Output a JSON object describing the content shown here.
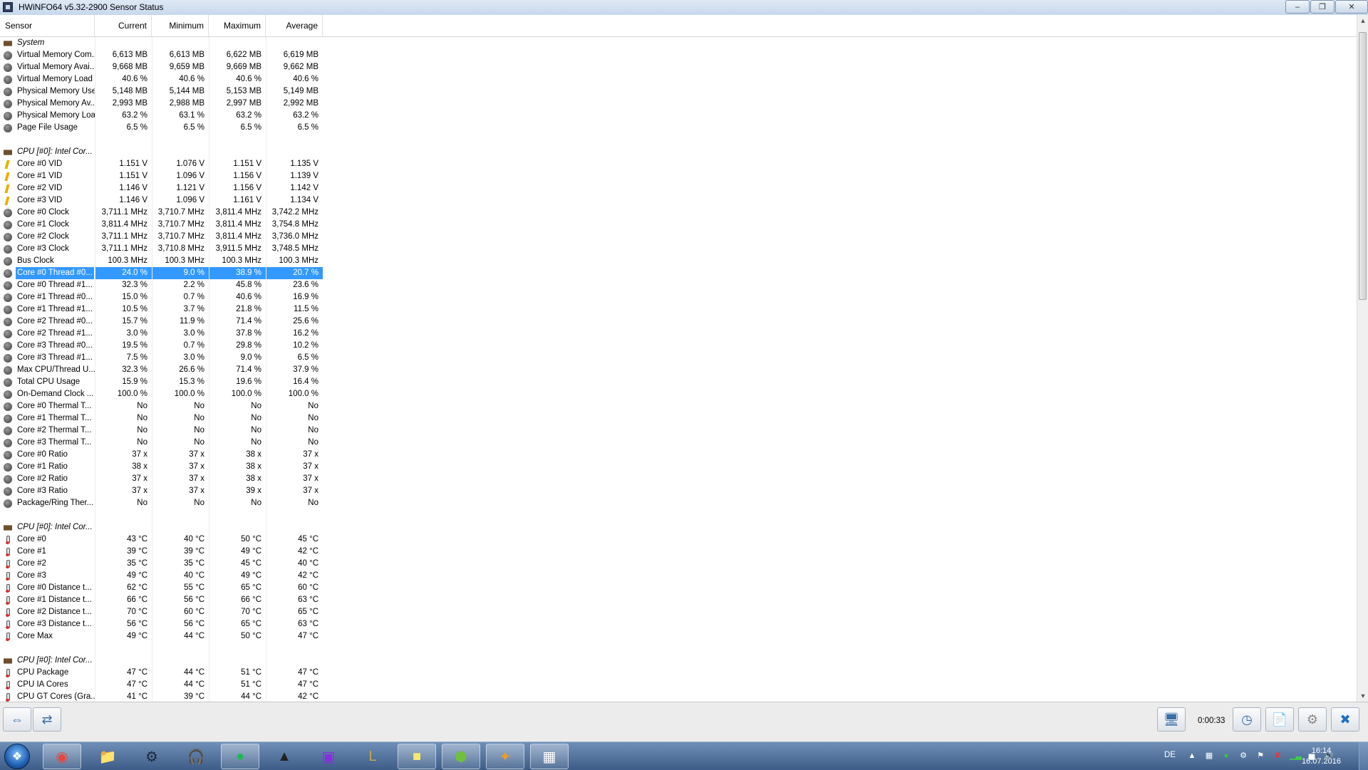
{
  "window": {
    "title": "HWiNFO64 v5.32-2900 Sensor Status"
  },
  "columns": [
    "Sensor",
    "Current",
    "Minimum",
    "Maximum",
    "Average"
  ],
  "rows": [
    {
      "type": "group",
      "icon": "chip-icon",
      "name": "System",
      "v": [
        "",
        "",
        "",
        ""
      ]
    },
    {
      "type": "item",
      "icon": "circle",
      "name": "Virtual Memory Com...",
      "v": [
        "6,613 MB",
        "6,613 MB",
        "6,622 MB",
        "6,619 MB"
      ]
    },
    {
      "type": "item",
      "icon": "circle",
      "name": "Virtual Memory Avai...",
      "v": [
        "9,668 MB",
        "9,659 MB",
        "9,669 MB",
        "9,662 MB"
      ]
    },
    {
      "type": "item",
      "icon": "circle",
      "name": "Virtual Memory Load",
      "v": [
        "40.6 %",
        "40.6 %",
        "40.6 %",
        "40.6 %"
      ]
    },
    {
      "type": "item",
      "icon": "circle",
      "name": "Physical Memory Used",
      "v": [
        "5,148 MB",
        "5,144 MB",
        "5,153 MB",
        "5,149 MB"
      ]
    },
    {
      "type": "item",
      "icon": "circle",
      "name": "Physical Memory Av...",
      "v": [
        "2,993 MB",
        "2,988 MB",
        "2,997 MB",
        "2,992 MB"
      ]
    },
    {
      "type": "item",
      "icon": "circle",
      "name": "Physical Memory Load",
      "v": [
        "63.2 %",
        "63.1 %",
        "63.2 %",
        "63.2 %"
      ]
    },
    {
      "type": "item",
      "icon": "circle",
      "name": "Page File Usage",
      "v": [
        "6.5 %",
        "6.5 %",
        "6.5 %",
        "6.5 %"
      ]
    },
    {
      "type": "blank",
      "icon": "",
      "name": "",
      "v": [
        "",
        "",
        "",
        ""
      ]
    },
    {
      "type": "group",
      "icon": "chip-icon",
      "name": "CPU [#0]: Intel Cor...",
      "v": [
        "",
        "",
        "",
        ""
      ]
    },
    {
      "type": "item",
      "icon": "volt",
      "name": "Core #0 VID",
      "v": [
        "1.151 V",
        "1.076 V",
        "1.151 V",
        "1.135 V"
      ]
    },
    {
      "type": "item",
      "icon": "volt",
      "name": "Core #1 VID",
      "v": [
        "1.151 V",
        "1.096 V",
        "1.156 V",
        "1.139 V"
      ]
    },
    {
      "type": "item",
      "icon": "volt",
      "name": "Core #2 VID",
      "v": [
        "1.146 V",
        "1.121 V",
        "1.156 V",
        "1.142 V"
      ]
    },
    {
      "type": "item",
      "icon": "volt",
      "name": "Core #3 VID",
      "v": [
        "1.146 V",
        "1.096 V",
        "1.161 V",
        "1.134 V"
      ]
    },
    {
      "type": "item",
      "icon": "circle",
      "name": "Core #0 Clock",
      "v": [
        "3,711.1 MHz",
        "3,710.7 MHz",
        "3,811.4 MHz",
        "3,742.2 MHz"
      ]
    },
    {
      "type": "item",
      "icon": "circle",
      "name": "Core #1 Clock",
      "v": [
        "3,811.4 MHz",
        "3,710.7 MHz",
        "3,811.4 MHz",
        "3,754.8 MHz"
      ]
    },
    {
      "type": "item",
      "icon": "circle",
      "name": "Core #2 Clock",
      "v": [
        "3,711.1 MHz",
        "3,710.7 MHz",
        "3,811.4 MHz",
        "3,736.0 MHz"
      ]
    },
    {
      "type": "item",
      "icon": "circle",
      "name": "Core #3 Clock",
      "v": [
        "3,711.1 MHz",
        "3,710.8 MHz",
        "3,911.5 MHz",
        "3,748.5 MHz"
      ]
    },
    {
      "type": "item",
      "icon": "circle",
      "name": "Bus Clock",
      "v": [
        "100.3 MHz",
        "100.3 MHz",
        "100.3 MHz",
        "100.3 MHz"
      ]
    },
    {
      "type": "item",
      "icon": "circle",
      "name": "Core #0 Thread #0...",
      "v": [
        "24.0 %",
        "9.0 %",
        "38.9 %",
        "20.7 %"
      ],
      "selected": true
    },
    {
      "type": "item",
      "icon": "circle",
      "name": "Core #0 Thread #1...",
      "v": [
        "32.3 %",
        "2.2 %",
        "45.8 %",
        "23.6 %"
      ]
    },
    {
      "type": "item",
      "icon": "circle",
      "name": "Core #1 Thread #0...",
      "v": [
        "15.0 %",
        "0.7 %",
        "40.6 %",
        "16.9 %"
      ]
    },
    {
      "type": "item",
      "icon": "circle",
      "name": "Core #1 Thread #1...",
      "v": [
        "10.5 %",
        "3.7 %",
        "21.8 %",
        "11.5 %"
      ]
    },
    {
      "type": "item",
      "icon": "circle",
      "name": "Core #2 Thread #0...",
      "v": [
        "15.7 %",
        "11.9 %",
        "71.4 %",
        "25.6 %"
      ]
    },
    {
      "type": "item",
      "icon": "circle",
      "name": "Core #2 Thread #1...",
      "v": [
        "3.0 %",
        "3.0 %",
        "37.8 %",
        "16.2 %"
      ]
    },
    {
      "type": "item",
      "icon": "circle",
      "name": "Core #3 Thread #0...",
      "v": [
        "19.5 %",
        "0.7 %",
        "29.8 %",
        "10.2 %"
      ]
    },
    {
      "type": "item",
      "icon": "circle",
      "name": "Core #3 Thread #1...",
      "v": [
        "7.5 %",
        "3.0 %",
        "9.0 %",
        "6.5 %"
      ]
    },
    {
      "type": "item",
      "icon": "circle",
      "name": "Max CPU/Thread U...",
      "v": [
        "32.3 %",
        "26.6 %",
        "71.4 %",
        "37.9 %"
      ]
    },
    {
      "type": "item",
      "icon": "circle",
      "name": "Total CPU Usage",
      "v": [
        "15.9 %",
        "15.3 %",
        "19.6 %",
        "16.4 %"
      ]
    },
    {
      "type": "item",
      "icon": "circle",
      "name": "On-Demand Clock ...",
      "v": [
        "100.0 %",
        "100.0 %",
        "100.0 %",
        "100.0 %"
      ]
    },
    {
      "type": "item",
      "icon": "circle",
      "name": "Core #0 Thermal T...",
      "v": [
        "No",
        "No",
        "No",
        "No"
      ]
    },
    {
      "type": "item",
      "icon": "circle",
      "name": "Core #1 Thermal T...",
      "v": [
        "No",
        "No",
        "No",
        "No"
      ]
    },
    {
      "type": "item",
      "icon": "circle",
      "name": "Core #2 Thermal T...",
      "v": [
        "No",
        "No",
        "No",
        "No"
      ]
    },
    {
      "type": "item",
      "icon": "circle",
      "name": "Core #3 Thermal T...",
      "v": [
        "No",
        "No",
        "No",
        "No"
      ]
    },
    {
      "type": "item",
      "icon": "circle",
      "name": "Core #0 Ratio",
      "v": [
        "37 x",
        "37 x",
        "38 x",
        "37 x"
      ]
    },
    {
      "type": "item",
      "icon": "circle",
      "name": "Core #1 Ratio",
      "v": [
        "38 x",
        "37 x",
        "38 x",
        "37 x"
      ]
    },
    {
      "type": "item",
      "icon": "circle",
      "name": "Core #2 Ratio",
      "v": [
        "37 x",
        "37 x",
        "38 x",
        "37 x"
      ]
    },
    {
      "type": "item",
      "icon": "circle",
      "name": "Core #3 Ratio",
      "v": [
        "37 x",
        "37 x",
        "39 x",
        "37 x"
      ]
    },
    {
      "type": "item",
      "icon": "circle",
      "name": "Package/Ring Ther...",
      "v": [
        "No",
        "No",
        "No",
        "No"
      ]
    },
    {
      "type": "blank",
      "icon": "",
      "name": "",
      "v": [
        "",
        "",
        "",
        ""
      ]
    },
    {
      "type": "group",
      "icon": "chip-icon",
      "name": "CPU [#0]: Intel Cor...",
      "v": [
        "",
        "",
        "",
        ""
      ]
    },
    {
      "type": "item",
      "icon": "therm",
      "name": "Core #0",
      "v": [
        "43 °C",
        "40 °C",
        "50 °C",
        "45 °C"
      ]
    },
    {
      "type": "item",
      "icon": "therm",
      "name": "Core #1",
      "v": [
        "39 °C",
        "39 °C",
        "49 °C",
        "42 °C"
      ]
    },
    {
      "type": "item",
      "icon": "therm",
      "name": "Core #2",
      "v": [
        "35 °C",
        "35 °C",
        "45 °C",
        "40 °C"
      ]
    },
    {
      "type": "item",
      "icon": "therm",
      "name": "Core #3",
      "v": [
        "49 °C",
        "40 °C",
        "49 °C",
        "42 °C"
      ]
    },
    {
      "type": "item",
      "icon": "therm",
      "name": "Core #0 Distance t...",
      "v": [
        "62 °C",
        "55 °C",
        "65 °C",
        "60 °C"
      ]
    },
    {
      "type": "item",
      "icon": "therm",
      "name": "Core #1 Distance t...",
      "v": [
        "66 °C",
        "56 °C",
        "66 °C",
        "63 °C"
      ]
    },
    {
      "type": "item",
      "icon": "therm",
      "name": "Core #2 Distance t...",
      "v": [
        "70 °C",
        "60 °C",
        "70 °C",
        "65 °C"
      ]
    },
    {
      "type": "item",
      "icon": "therm",
      "name": "Core #3 Distance t...",
      "v": [
        "56 °C",
        "56 °C",
        "65 °C",
        "63 °C"
      ]
    },
    {
      "type": "item",
      "icon": "therm",
      "name": "Core Max",
      "v": [
        "49 °C",
        "44 °C",
        "50 °C",
        "47 °C"
      ]
    },
    {
      "type": "blank",
      "icon": "",
      "name": "",
      "v": [
        "",
        "",
        "",
        ""
      ]
    },
    {
      "type": "group",
      "icon": "chip-icon",
      "name": "CPU [#0]: Intel Cor...",
      "v": [
        "",
        "",
        "",
        ""
      ]
    },
    {
      "type": "item",
      "icon": "therm",
      "name": "CPU Package",
      "v": [
        "47 °C",
        "44 °C",
        "51 °C",
        "47 °C"
      ]
    },
    {
      "type": "item",
      "icon": "therm",
      "name": "CPU IA Cores",
      "v": [
        "47 °C",
        "44 °C",
        "51 °C",
        "47 °C"
      ]
    },
    {
      "type": "item",
      "icon": "therm",
      "name": "CPU GT Cores (Gra...",
      "v": [
        "41 °C",
        "39 °C",
        "44 °C",
        "42 °C"
      ]
    }
  ],
  "toolbar": {
    "nav_expand_icon": "arrows-left-right-icon",
    "nav_collapse_icon": "arrows-inward-icon",
    "network_icon": "network-computers-icon",
    "timer": "0:00:33",
    "clock_icon": "clock-icon",
    "log_icon": "add-log-icon",
    "settings_icon": "gear-icon",
    "close_icon": "close-icon"
  },
  "taskbar": {
    "apps": [
      "chrome-icon",
      "explorer-folder-icon",
      "steam-icon",
      "teamspeak-icon",
      "spotify-icon",
      "mouse-app-icon",
      "game-controller-icon",
      "league-icon",
      "sticky-notes-icon",
      "xbox-app-icon",
      "csgo-icon",
      "hwinfo-icon"
    ],
    "language": "DE",
    "time": "16:14",
    "date": "16.07.2016"
  },
  "colors": {
    "selection": "#3399ff",
    "spotify": "#1db954"
  }
}
